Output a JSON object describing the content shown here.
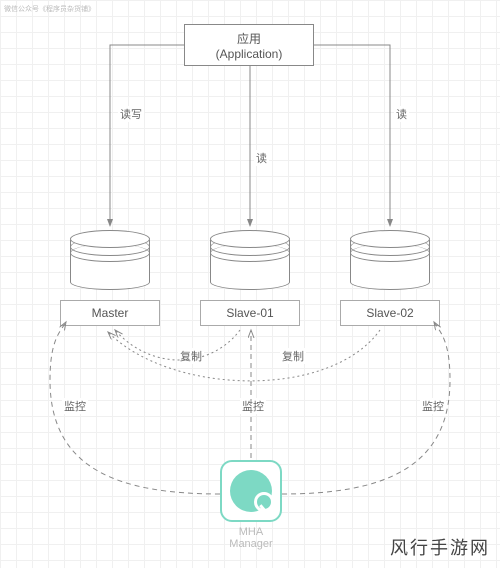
{
  "watermark_top": "微信公众号《程序员杂货铺》",
  "watermark_bottom": "风行手游网",
  "app": {
    "line1": "应用",
    "line2": "(Application)"
  },
  "nodes": {
    "master": "Master",
    "slave1": "Slave-01",
    "slave2": "Slave-02",
    "mha_line1": "MHA",
    "mha_line2": "Manager"
  },
  "edges": {
    "read_write": "读写",
    "read_center": "读",
    "read_right": "读",
    "replicate_left": "复制",
    "replicate_right": "复制",
    "monitor_left": "监控",
    "monitor_center": "监控",
    "monitor_right": "监控"
  }
}
